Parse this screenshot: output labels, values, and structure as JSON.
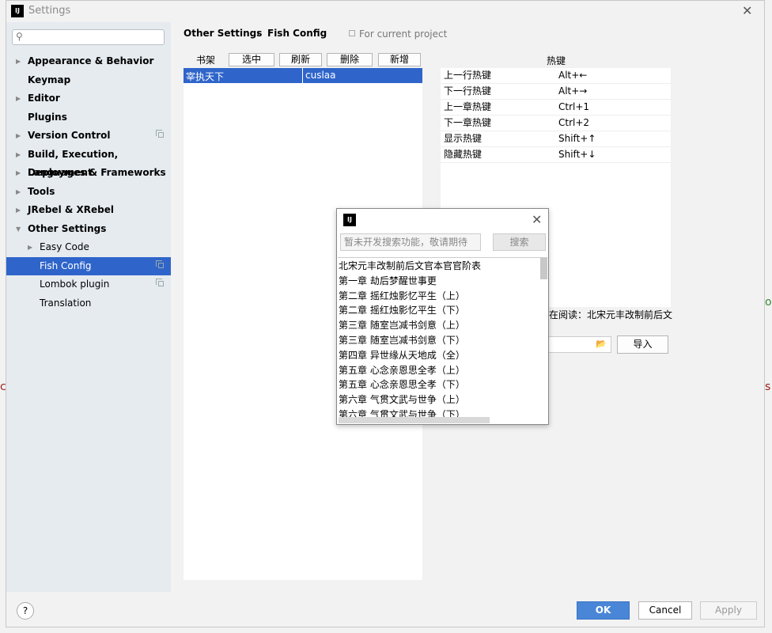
{
  "window": {
    "title": "Settings",
    "app_icon": "IJ"
  },
  "search": {
    "placeholder": ""
  },
  "sidebar": {
    "items": [
      {
        "label": "Appearance & Behavior",
        "expandable": true,
        "bold": true
      },
      {
        "label": "Keymap",
        "expandable": false,
        "bold": true
      },
      {
        "label": "Editor",
        "expandable": true,
        "bold": true
      },
      {
        "label": "Plugins",
        "expandable": false,
        "bold": true
      },
      {
        "label": "Version Control",
        "expandable": true,
        "bold": true,
        "project_icon": true
      },
      {
        "label": "Build, Execution, Deployment",
        "expandable": true,
        "bold": true
      },
      {
        "label": "Languages & Frameworks",
        "expandable": true,
        "bold": true
      },
      {
        "label": "Tools",
        "expandable": true,
        "bold": true
      },
      {
        "label": "JRebel & XRebel",
        "expandable": true,
        "bold": true
      },
      {
        "label": "Other Settings",
        "expanded": true,
        "bold": true
      },
      {
        "label": "Easy Code",
        "expandable": true,
        "child": true
      },
      {
        "label": "Fish Config",
        "child": true,
        "selected": true,
        "project_icon": true
      },
      {
        "label": "Lombok plugin",
        "child": true,
        "project_icon": true
      },
      {
        "label": "Translation",
        "child": true
      }
    ]
  },
  "breadcrumb": {
    "parent": "Other Settings",
    "separator": "›",
    "current": "Fish Config",
    "scope": "For current project"
  },
  "bookshelf": {
    "label": "书架",
    "buttons": {
      "select": "选中",
      "refresh": "刷新",
      "delete": "删除",
      "add": "新增"
    },
    "rows": [
      {
        "name": "宰执天下",
        "author": "cuslaa"
      }
    ]
  },
  "hotkeys": {
    "title": "热键",
    "rows": [
      {
        "name": "上一行热键",
        "key": "Alt+←"
      },
      {
        "name": "下一行热键",
        "key": "Alt+→"
      },
      {
        "name": "上一章热键",
        "key": "Ctrl+1"
      },
      {
        "name": "下一章热键",
        "key": "Ctrl+2"
      },
      {
        "name": "显示热键",
        "key": "Shift+↑"
      },
      {
        "name": "隐藏热键",
        "key": "Shift+↓"
      }
    ]
  },
  "reading": {
    "status": "在阅读：北宋元丰改制前后文"
  },
  "import": {
    "label": "导入"
  },
  "popup": {
    "app_icon": "IJ",
    "search_placeholder": "暂未开发搜索功能，敬请期待",
    "search_button": "搜索",
    "chapters": [
      "北宋元丰改制前后文官本官官阶表",
      "第一章 劫后梦醒世事更",
      "第二章 摇红烛影忆平生（上）",
      "第二章 摇红烛影忆平生（下）",
      "第三章 随室岂减书剑意（上）",
      "第三章 随室岂减书剑意（下）",
      "第四章 异世缘从天地成（全）",
      "第五章 心念亲恩思全孝（上）",
      "第五章 心念亲恩思全孝（下）",
      "第六章 气贯文武与世争（上）",
      "第六章 气贯文武与世争（下）"
    ]
  },
  "footer": {
    "help": "?",
    "ok": "OK",
    "cancel": "Cancel",
    "apply": "Apply"
  },
  "colors": {
    "accent": "#2f65ca",
    "sidebar_bg": "#e6ebf0",
    "ok_button": "#4a86d8"
  }
}
